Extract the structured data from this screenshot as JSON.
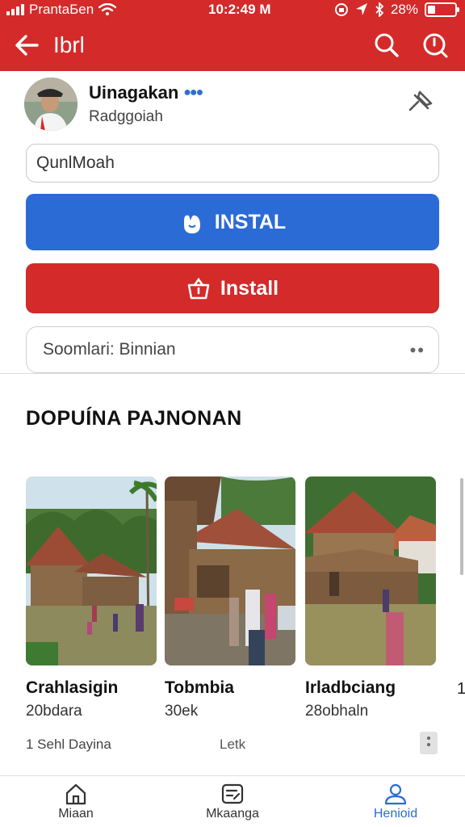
{
  "status_bar": {
    "carrier": "PrantaБen",
    "time": "10:2:49 M",
    "battery": "28%",
    "battery_level": 0.28
  },
  "header": {
    "title": "Ibrl",
    "back_icon": "arrow-left-icon",
    "search_icon": "search-icon",
    "info_icon": "search-circle-icon"
  },
  "profile": {
    "name": "Uinagakan",
    "verified_mark": "●●●",
    "subtitle": "Radggoiah",
    "pin_icon": "pin-icon"
  },
  "input": {
    "value": "QunlMoah"
  },
  "buttons": {
    "primary_label": "INSTAL",
    "secondary_label": "Install"
  },
  "select": {
    "value": "Soomlari: Binnian",
    "more": "••"
  },
  "section": {
    "title": "DOPUÍNA PAJNONAN"
  },
  "cards": [
    {
      "name": "Crahlasigin",
      "meta": "20bdara"
    },
    {
      "name": "Tobmbia",
      "meta": "30ek"
    },
    {
      "name": "Irladbciang",
      "meta": "28obhaln"
    }
  ],
  "scroll_peek": "1",
  "footer": {
    "left": "1 Sehl Dayina",
    "middle": "Letk"
  },
  "bottom_nav": [
    {
      "label": "Miaan",
      "icon": "home-icon"
    },
    {
      "label": "Mkaanga",
      "icon": "edit-icon"
    },
    {
      "label": "Henioid",
      "icon": "profile-icon"
    }
  ],
  "colors": {
    "header_red": "#d42a2a",
    "primary_blue": "#2b6bd6",
    "install_red": "#d42a2a"
  }
}
